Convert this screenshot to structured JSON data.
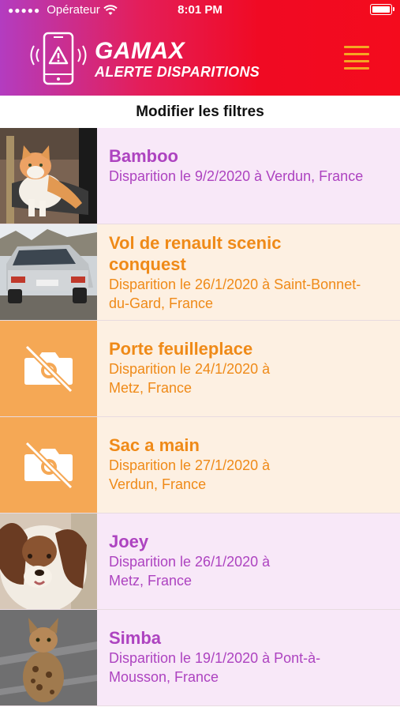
{
  "status_bar": {
    "carrier": "Opérateur",
    "time": "8:01 PM"
  },
  "header": {
    "title": "GAMAX",
    "subtitle": "ALERTE DISPARITIONS",
    "menu_icon": "hamburger-icon",
    "logo_icon": "phone-alert-icon"
  },
  "filter_label": "Modifier les filtres",
  "colors": {
    "purple": "#ad43c0",
    "orange": "#ef8a18",
    "menu": "#f5a623"
  },
  "items": [
    {
      "title": "Bamboo",
      "desc": "Disparition le 9/2/2020 à Verdun, France"
    },
    {
      "title": "Vol de renault scenic conquest",
      "desc": "Disparition le 26/1/2020 à Saint-Bonnet-du-Gard, France"
    },
    {
      "title": "Porte feuilleplace",
      "desc": "Disparition le 24/1/2020 à Metz, France"
    },
    {
      "title": "Sac a main",
      "desc": "Disparition le 27/1/2020 à Verdun, France"
    },
    {
      "title": "Joey",
      "desc": "Disparition le 26/1/2020 à Metz, France"
    },
    {
      "title": "Simba",
      "desc": "Disparition le 19/1/2020 à Pont-à-Mousson, France"
    }
  ]
}
